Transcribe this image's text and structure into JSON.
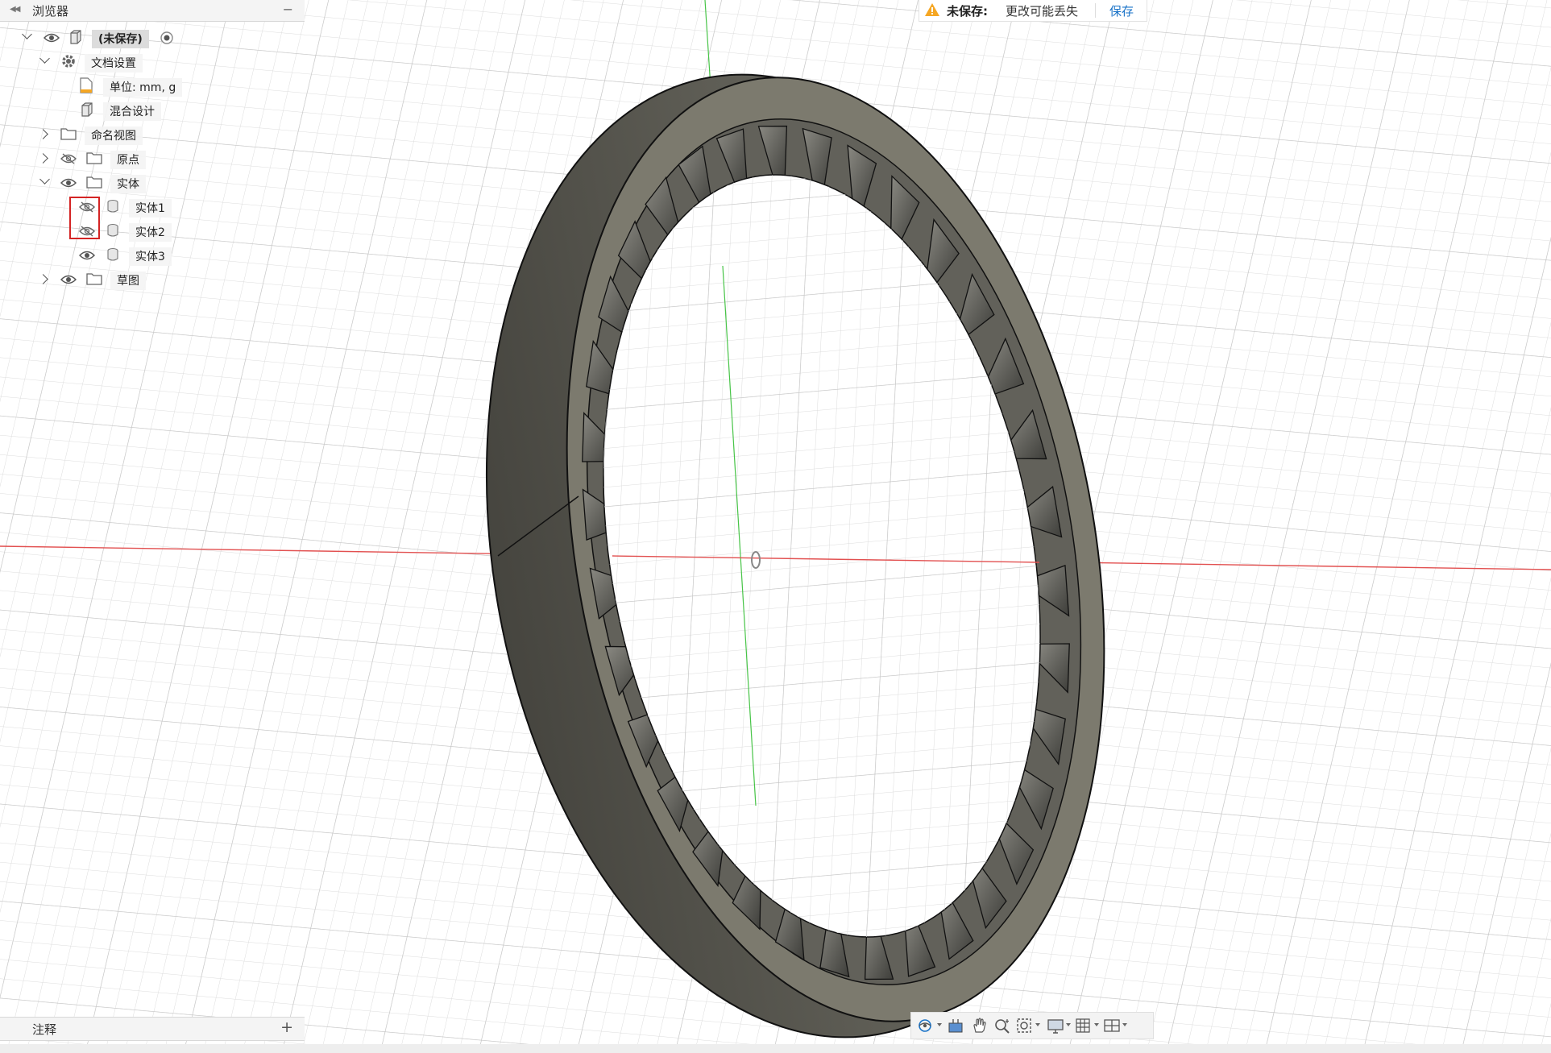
{
  "browser": {
    "title": "浏览器",
    "root": {
      "label": "(未保存)"
    },
    "items": [
      {
        "label": "文档设置"
      },
      {
        "label": "单位: mm, g"
      },
      {
        "label": "混合设计"
      },
      {
        "label": "命名视图"
      },
      {
        "label": "原点"
      },
      {
        "label": "实体"
      },
      {
        "label": "实体1",
        "visible": false
      },
      {
        "label": "实体2",
        "visible": false
      },
      {
        "label": "实体3",
        "visible": true
      },
      {
        "label": "草图"
      }
    ]
  },
  "notice": {
    "label": "未保存:",
    "message": "更改可能丢失",
    "save": "保存"
  },
  "annotations": {
    "title": "注释"
  },
  "toolbar": {
    "items": [
      "orbit-icon",
      "look-at-icon",
      "pan-icon",
      "zoom-icon",
      "fit-icon",
      "display-settings-icon",
      "grid-icon",
      "viewports-icon"
    ]
  },
  "colors": {
    "accent": "#1a73c8",
    "highlight": "#d42424",
    "warning": "#f5a623",
    "axis_x": "#e25050",
    "axis_y": "#47c447",
    "gear_face": "#7c7a6e",
    "gear_rim": "#55544c"
  }
}
